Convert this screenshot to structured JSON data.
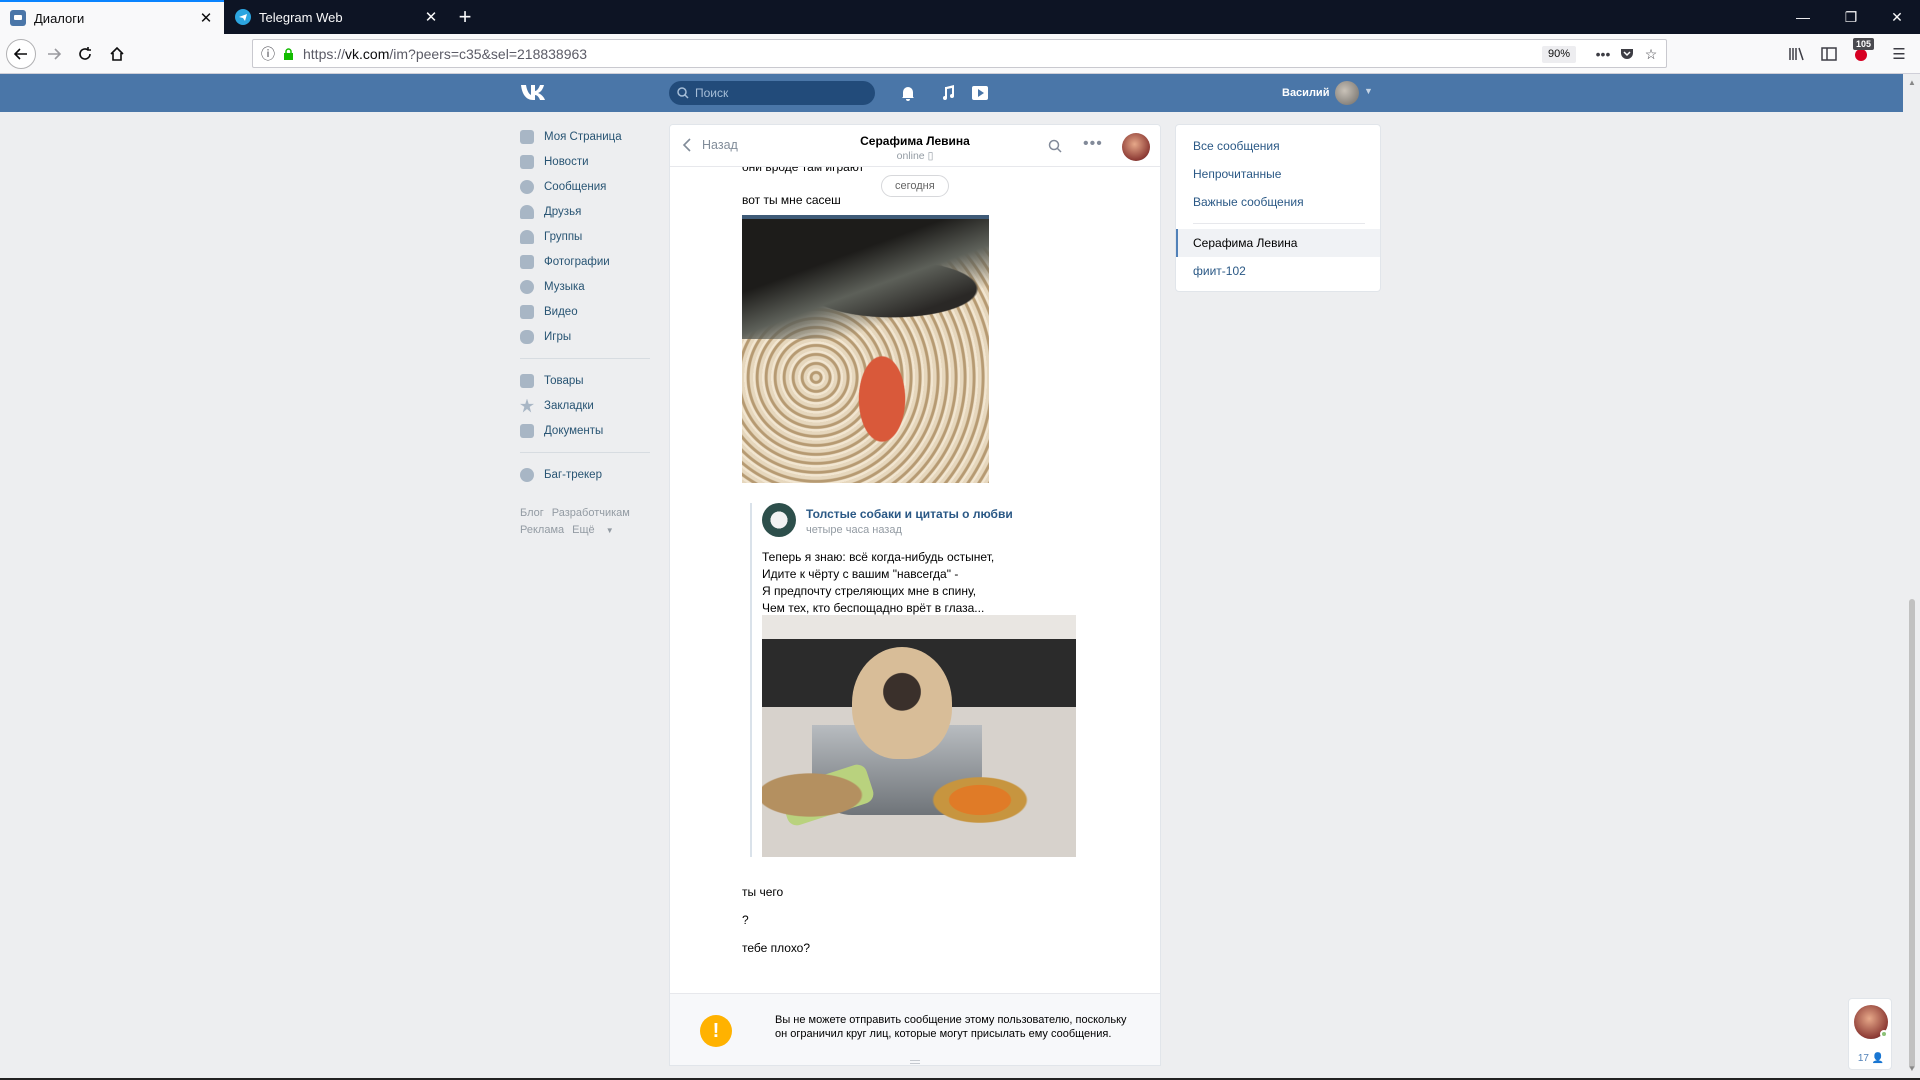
{
  "browser": {
    "tabs": [
      {
        "label": "Диалоги",
        "active": true
      },
      {
        "label": "Telegram Web",
        "active": false
      }
    ],
    "url": {
      "scheme": "https://",
      "host": "vk.com",
      "path": "/im?peers=c35&sel=218838963"
    },
    "zoom": "90%",
    "extension_badge": "105"
  },
  "vk": {
    "search_placeholder": "Поиск",
    "user_name": "Василий",
    "menu": [
      {
        "label": "Моя Страница",
        "icon": "home-icon"
      },
      {
        "label": "Новости",
        "icon": "news-icon"
      },
      {
        "label": "Сообщения",
        "icon": "messages-icon"
      },
      {
        "label": "Друзья",
        "icon": "friends-icon"
      },
      {
        "label": "Группы",
        "icon": "groups-icon"
      },
      {
        "label": "Фотографии",
        "icon": "photos-icon"
      },
      {
        "label": "Музыка",
        "icon": "music-icon"
      },
      {
        "label": "Видео",
        "icon": "video-icon"
      },
      {
        "label": "Игры",
        "icon": "games-icon"
      }
    ],
    "menu2": [
      {
        "label": "Товары",
        "icon": "goods-icon"
      },
      {
        "label": "Закладки",
        "icon": "bookmarks-icon"
      },
      {
        "label": "Документы",
        "icon": "documents-icon"
      }
    ],
    "menu3": [
      {
        "label": "Баг-трекер",
        "icon": "bug-icon"
      }
    ],
    "footer": [
      "Блог",
      "Разработчикам",
      "Реклама",
      "Ещё"
    ]
  },
  "dialog": {
    "back_label": "Назад",
    "name": "Серафима Левина",
    "status": "online",
    "date_divider": "сегодня",
    "messages": {
      "m0": "они вроде там играют",
      "m1": "вот ты мне сасеш",
      "m2": "ты чего",
      "m3": "?",
      "m4": "тебе плохо?"
    },
    "repost": {
      "source": "Толстые собаки и цитаты о любви",
      "time": "четыре часа назад",
      "text": "Теперь я знаю: всё когда-нибудь остынет,\nИдите к чёрту с вашим \"навсегда\" -\nЯ предпочту стреляющих мне в спину,\nЧем тех, кто беспощадно врёт в глаза..."
    },
    "notice": "Вы не можете отправить сообщение этому пользователю, поскольку он ограничил круг лиц, которые могут присылать ему сообщения."
  },
  "filters": {
    "items": [
      "Все сообщения",
      "Непрочитанные",
      "Важные сообщения"
    ],
    "conversations": [
      "Серафима Левина",
      "фиит-102"
    ]
  },
  "chat_widget": {
    "count": "17"
  },
  "colors": {
    "vk_blue": "#4a76a8",
    "link": "#2a5885",
    "warning": "#ffb200"
  }
}
